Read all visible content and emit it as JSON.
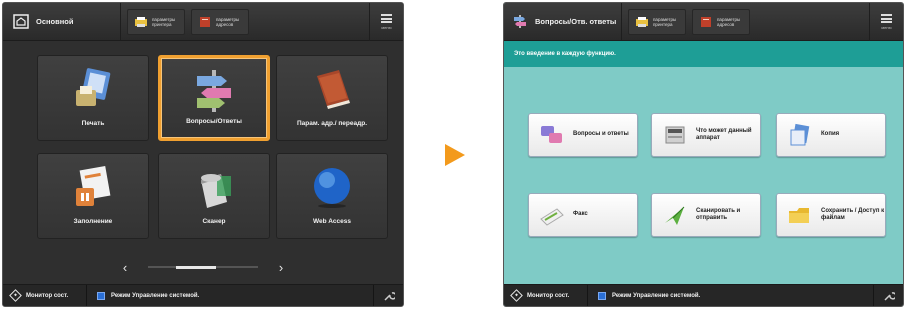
{
  "left_screen": {
    "header": {
      "title": "Основной",
      "shortcuts": [
        {
          "label": "параметры принтера",
          "icon": "printer-settings-icon"
        },
        {
          "label": "параметры адресов",
          "icon": "address-book-icon"
        }
      ],
      "menu_label": "меню"
    },
    "tiles": [
      {
        "label": "Печать",
        "icon": "print-icon",
        "selected": false
      },
      {
        "label": "Вопросы/Ответы",
        "icon": "signpost-icon",
        "selected": true
      },
      {
        "label": "Парам. адр./ переадр.",
        "icon": "book-icon",
        "selected": false
      },
      {
        "label": "Заполнение",
        "icon": "form-fill-icon",
        "selected": false
      },
      {
        "label": "Сканер",
        "icon": "scanner-icon",
        "selected": false
      },
      {
        "label": "Web Access",
        "icon": "globe-icon",
        "selected": false
      }
    ],
    "pager": {
      "prev": "‹",
      "next": "›"
    },
    "footer": {
      "monitor": "Монитор сост.",
      "status": "Режим Управление системой."
    }
  },
  "right_screen": {
    "header": {
      "title": "Вопросы/Отв. ответы",
      "shortcuts": [
        {
          "label": "параметры принтера",
          "icon": "printer-settings-icon"
        },
        {
          "label": "параметры адресов",
          "icon": "address-book-icon"
        }
      ],
      "menu_label": "меню"
    },
    "info": "Это введение в каждую функцию.",
    "buttons": [
      {
        "label": "Вопросы и ответы",
        "icon": "qa-icon"
      },
      {
        "label": "Что может данный аппарат",
        "icon": "device-icon"
      },
      {
        "label": "Копия",
        "icon": "copy-icon"
      },
      {
        "label": "Факс",
        "icon": "fax-icon"
      },
      {
        "label": "Сканировать и отправить",
        "icon": "scan-send-icon"
      },
      {
        "label": "Сохранить / Доступ к файлам",
        "icon": "folder-icon"
      }
    ],
    "footer": {
      "monitor": "Монитор сост.",
      "status": "Режим Управление системой."
    }
  },
  "colors": {
    "selected_border": "#f0a030",
    "arrow": "#f39a1c",
    "teal_bg": "#7fcbc6",
    "teal_strip": "#1e9e96"
  }
}
